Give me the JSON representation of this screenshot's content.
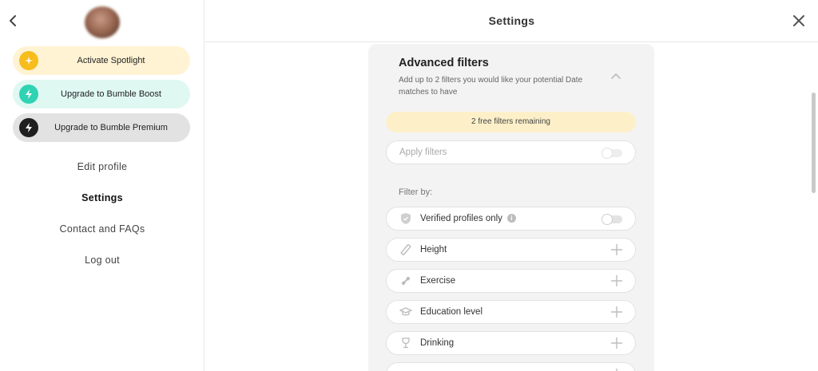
{
  "header": {
    "title": "Settings"
  },
  "sidebar": {
    "upgrades": [
      {
        "label": "Activate Spotlight"
      },
      {
        "label": "Upgrade to Bumble Boost"
      },
      {
        "label": "Upgrade to Bumble Premium"
      }
    ],
    "nav": [
      {
        "label": "Edit profile"
      },
      {
        "label": "Settings"
      },
      {
        "label": "Contact and FAQs"
      },
      {
        "label": "Log out"
      }
    ]
  },
  "advanced_filters": {
    "title": "Advanced filters",
    "description": "Add up to 2 filters you would like your potential Date matches to have",
    "free_remaining": "2 free filters remaining",
    "apply_filters": {
      "label": "Apply filters",
      "enabled": false
    },
    "filter_by_label": "Filter by:",
    "verified": {
      "label": "Verified profiles only",
      "info": "i",
      "enabled": false
    },
    "filters": [
      {
        "label": "Height",
        "icon": "ruler-icon"
      },
      {
        "label": "Exercise",
        "icon": "exercise-icon"
      },
      {
        "label": "Education level",
        "icon": "graduation-cap-icon"
      },
      {
        "label": "Drinking",
        "icon": "wine-glass-icon"
      }
    ]
  },
  "colors": {
    "spotlight": "#f6bd1d",
    "boost": "#2fd3b3",
    "premium": "#1f1f1f",
    "banner": "#fdf0c9"
  }
}
